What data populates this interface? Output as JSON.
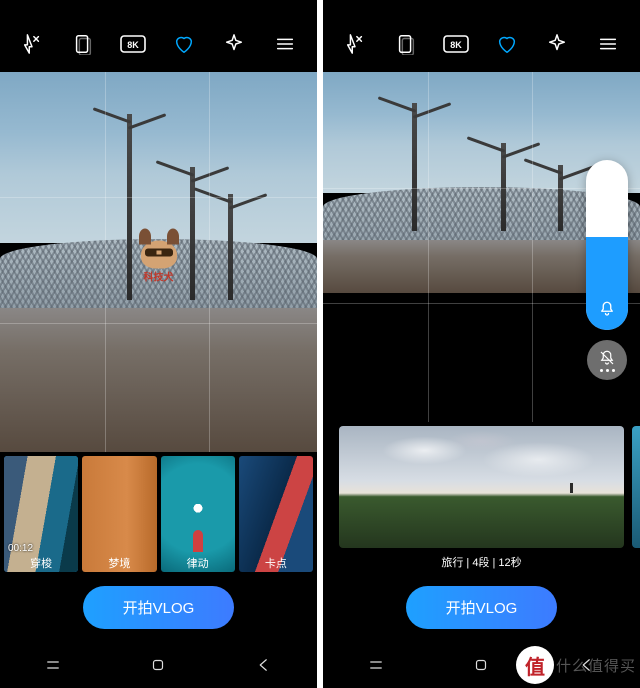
{
  "accent": "#1e9dff",
  "icons": [
    "flash-off-icon",
    "aspect-icon",
    "8k-icon",
    "heart-icon",
    "sparkle-icon",
    "menu-icon"
  ],
  "left": {
    "thumbs": [
      {
        "label": "穿梭",
        "badge": "00:12",
        "selected": true
      },
      {
        "label": "梦境",
        "badge": "",
        "selected": false
      },
      {
        "label": "律动",
        "badge": "",
        "selected": false
      },
      {
        "label": "卡点",
        "badge": "",
        "selected": false
      }
    ],
    "cta": "开拍VLOG"
  },
  "right": {
    "wide_label": "旅行 | 4段 | 12秒",
    "cta": "开拍VLOG",
    "volume_pct": 55
  },
  "mascot_text": "科技犬",
  "corner": {
    "char": "值",
    "text": "什么值得买"
  }
}
